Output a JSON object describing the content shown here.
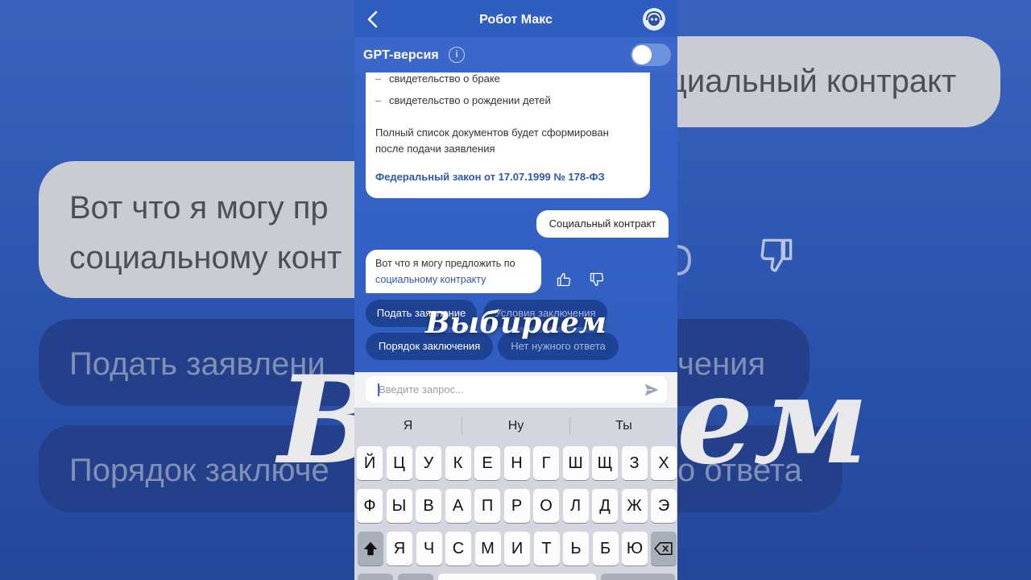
{
  "app": {
    "title": "Робот Макс",
    "gpt_label": "GPT-версия",
    "info_glyph": "i",
    "gpt_enabled": false,
    "accent": "#3461c4"
  },
  "chat": {
    "card": {
      "items": [
        "свидетельство о браке",
        "свидетельство о рождении детей"
      ],
      "bullet": "–",
      "paragraph_line1": "Полный список документов будет сформирован",
      "paragraph_line2": "после подачи заявления",
      "law_link": "Федеральный закон от 17.07.1999 № 178-ФЗ"
    },
    "user_message": "Социальный контракт",
    "bot_message_line1": "Вот что я могу предложить по",
    "bot_message_line2": "социальному контракту",
    "options": [
      "Подать заявление",
      "Условия заключения",
      "Порядок заключения",
      "Нет нужного ответа"
    ]
  },
  "overlay_caption": "Выбираем",
  "input": {
    "placeholder": "Введите запрос..."
  },
  "keyboard": {
    "suggestions": [
      "Я",
      "Ну",
      "Ты"
    ],
    "row1": [
      "Й",
      "Ц",
      "У",
      "К",
      "Е",
      "Н",
      "Г",
      "Ш",
      "Щ",
      "З",
      "Х"
    ],
    "row2": [
      "Ф",
      "Ы",
      "В",
      "А",
      "П",
      "Р",
      "О",
      "Л",
      "Д",
      "Ж",
      "Э"
    ],
    "row3": [
      "Я",
      "Ч",
      "С",
      "М",
      "И",
      "Т",
      "Ь",
      "Б",
      "Ю"
    ]
  },
  "background": {
    "bubble1": "циальный контракт",
    "bubble2_line1": "Вот что я могу пр",
    "bubble2_line2": "социальному конт",
    "pill1": "Подать заявлени",
    "pill2": "чения",
    "pill3": "Порядок заключе",
    "pill4": "о ответа",
    "big1": "Вь",
    "big2": "ем"
  }
}
